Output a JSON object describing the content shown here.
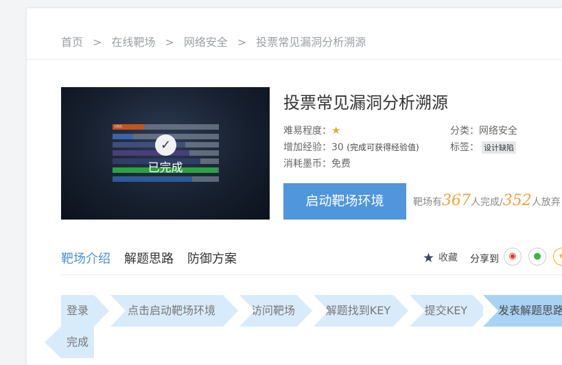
{
  "breadcrumb": {
    "items": [
      "首页",
      "在线靶场",
      "网络安全",
      "投票常见漏洞分析溯源"
    ],
    "separator": ">"
  },
  "thumbnail": {
    "status_label": "已完成"
  },
  "detail": {
    "title": "投票常见漏洞分析溯源",
    "difficulty_label": "难易程度：",
    "difficulty_stars": 1,
    "exp_label": "增加经验：",
    "exp_value": "30",
    "exp_note": "(完成可获得经验值)",
    "cost_label": "消耗墨币：",
    "cost_value": "免费",
    "category_label": "分类：",
    "category_value": "网络安全",
    "tag_label": "标签：",
    "tag_value": "设计缺陷"
  },
  "actions": {
    "start_label": "启动靶场环境",
    "stats_prefix": "靶场有",
    "completed_count": "367",
    "completed_suffix": "人完成/",
    "abandoned_count": "352",
    "abandoned_suffix": "人放弃"
  },
  "tabs": [
    {
      "label": "靶场介绍",
      "active": true
    },
    {
      "label": "解题思路",
      "active": false
    },
    {
      "label": "防御方案",
      "active": false
    }
  ],
  "social": {
    "favorite_label": "收藏",
    "share_label": "分享到"
  },
  "steps": [
    "登录",
    "点击启动靶场环境",
    "访问靶场",
    "解题找到KEY",
    "提交KEY",
    "发表解题思路",
    "完成"
  ],
  "colors": {
    "accent": "#4f96dc",
    "tab_active": "#4a8fd6",
    "stat_number": "#f4a13a",
    "star": "#f5a623",
    "step_bg": "#d8ebfb",
    "step_bg_active": "#a9d3f5"
  },
  "icons": {
    "check": "check-icon",
    "star": "star-icon",
    "favorite": "favorite-star-icon",
    "weibo": "weibo-icon",
    "wechat": "wechat-icon",
    "qzone": "qzone-icon"
  }
}
